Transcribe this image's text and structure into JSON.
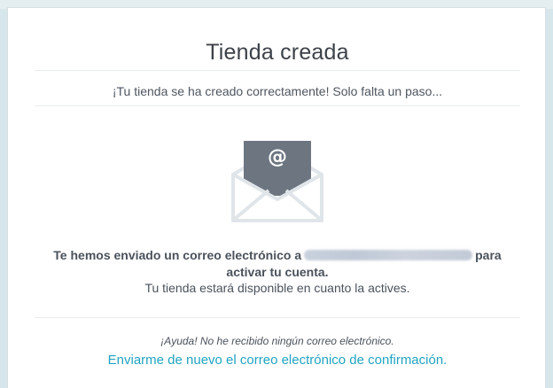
{
  "modal": {
    "title": "Tienda creada",
    "subtitle": "¡Tu tienda se ha creado correctamente! Solo falta un paso...",
    "message_bold_prefix": "Te hemos enviado un correo electrónico a",
    "message_bold_suffix_1": "para",
    "message_bold_suffix_2": "activar tu cuenta.",
    "message_normal": "Tu tienda estará disponible en cuanto la actives.",
    "help_text": "¡Ayuda! No he recibido ningún correo electrónico.",
    "resend_link": "Enviarme de nuevo el correo electrónico de confirmación.",
    "envelope_symbol": "@",
    "icon": "envelope-at-icon"
  },
  "colors": {
    "link": "#21a4c0",
    "envelope_dark": "#6c7580",
    "envelope_light": "#e3e7ec",
    "background": "#d6e6ea"
  }
}
